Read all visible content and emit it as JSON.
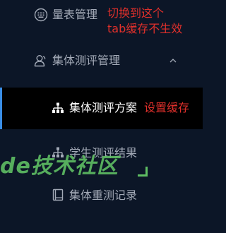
{
  "menu": {
    "scale_management": {
      "label": "量表管理",
      "icon": "keyboard-icon"
    },
    "group_eval_management": {
      "label": "集体测评管理",
      "icon": "user-icon",
      "expand_icon": "chevron-up-icon"
    },
    "group_eval_plan": {
      "label": "集体测评方案",
      "icon": "sitemap-icon",
      "active": true
    },
    "student_eval_results": {
      "label": "学生测评结果",
      "icon": "sitemap-icon"
    },
    "group_retest_record": {
      "label": "集体重测记录",
      "icon": "book-icon"
    }
  },
  "annotations": {
    "top_line1": "切换到这个",
    "top_line2": "tab缓存不生效",
    "set_cache": "设置缓存"
  },
  "watermark": {
    "text": "de技术社区"
  },
  "colors": {
    "background": "#0c1627",
    "active_background": "#000000",
    "active_indicator": "#3a8ee6",
    "menu_text": "#a3aab7",
    "active_text": "#ffffff",
    "annotation_red": "#e0302b",
    "watermark_green": "#5fbe63"
  }
}
